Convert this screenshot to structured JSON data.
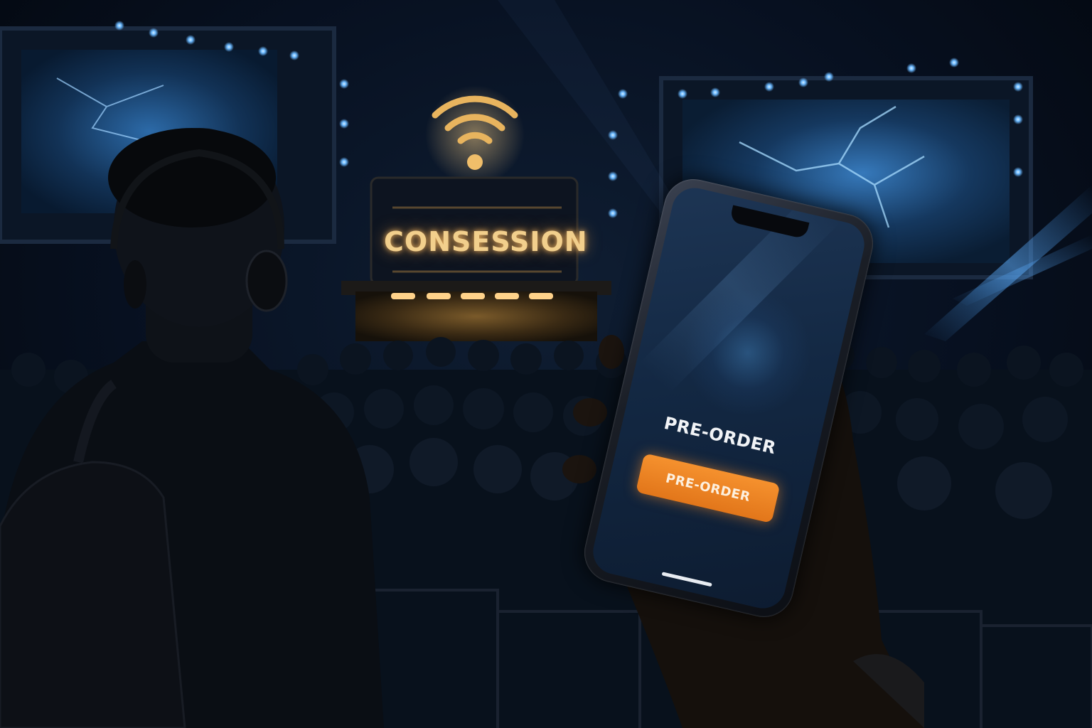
{
  "venue": {
    "sign_label": "CONSESSION",
    "wifi_icon": "wifi-icon",
    "accent_gold": "#f2cf8c",
    "accent_blue": "#3f8fe0"
  },
  "phone": {
    "screen_title": "PRE-ORDER",
    "button_label": "PRE-ORDER",
    "button_color": "#f0862a"
  }
}
